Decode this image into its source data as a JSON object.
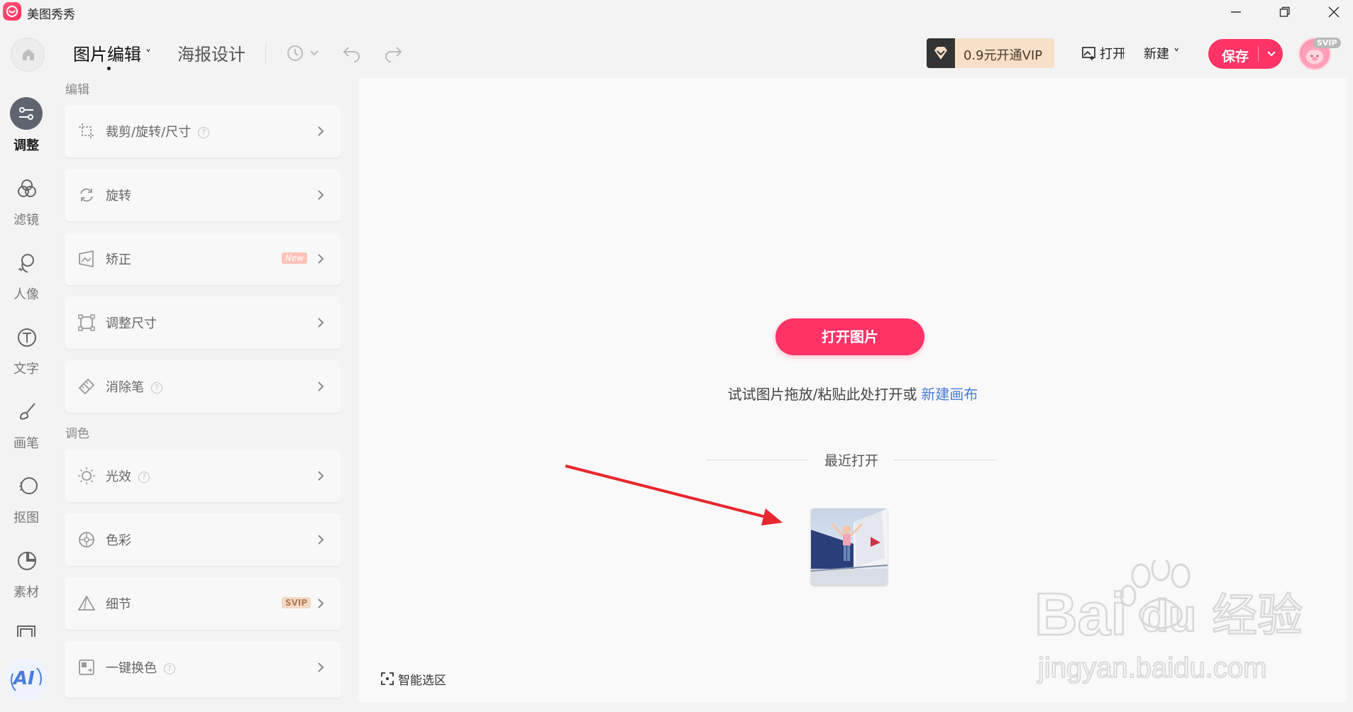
{
  "app": {
    "title": "美图秀秀"
  },
  "toolbar": {
    "tabs": [
      {
        "label": "图片编辑",
        "active": true
      },
      {
        "label": "海报设计",
        "active": false
      }
    ],
    "tab_caret": "˅",
    "vip_label": "0.9元开通VIP",
    "open_label": "打开",
    "new_label": "新建 ˅",
    "save_label": "保存",
    "avatar_badge": "SVIP"
  },
  "sidebar": {
    "items": [
      {
        "label": "调整",
        "icon": "sliders-icon",
        "active": true
      },
      {
        "label": "滤镜",
        "icon": "filter-circles-icon",
        "active": false
      },
      {
        "label": "人像",
        "icon": "portrait-icon",
        "active": false
      },
      {
        "label": "文字",
        "icon": "text-icon",
        "active": false
      },
      {
        "label": "画笔",
        "icon": "brush-icon",
        "active": false
      },
      {
        "label": "抠图",
        "icon": "cutout-icon",
        "active": false
      },
      {
        "label": "素材",
        "icon": "sticker-icon",
        "active": false
      }
    ],
    "ai_label": "AI"
  },
  "panel": {
    "sections": [
      {
        "title": "编辑"
      },
      {
        "title": "调色"
      }
    ],
    "tools": [
      {
        "label": "裁剪/旋转/尺寸",
        "icon": "crop-icon",
        "help": true,
        "tag": ""
      },
      {
        "label": "旋转",
        "icon": "rotate-icon",
        "help": false,
        "tag": ""
      },
      {
        "label": "矫正",
        "icon": "perspective-icon",
        "help": false,
        "tag": "New"
      },
      {
        "label": "调整尺寸",
        "icon": "resize-icon",
        "help": false,
        "tag": ""
      },
      {
        "label": "消除笔",
        "icon": "eraser-icon",
        "help": true,
        "tag": ""
      },
      {
        "label": "光效",
        "icon": "light-icon",
        "help": true,
        "tag": ""
      },
      {
        "label": "色彩",
        "icon": "color-palette-icon",
        "help": false,
        "tag": ""
      },
      {
        "label": "细节",
        "icon": "detail-triangle-icon",
        "help": false,
        "tag": "SVIP"
      },
      {
        "label": "一键换色",
        "icon": "color-swap-icon",
        "help": true,
        "tag": ""
      }
    ],
    "help_glyph": "?"
  },
  "canvas": {
    "open_image_label": "打开图片",
    "hint_text": "试试图片拖放/粘贴此处打开或",
    "hint_link": "新建画布",
    "recent_title": "最近打开",
    "smart_select_label": "智能选区"
  },
  "watermark": {
    "brand": "Bai",
    "brand_suffix": "du",
    "brand_cn": "经验",
    "url": "jingyan.baidu.com"
  },
  "colors": {
    "accent": "#ff3366",
    "link": "#4a7cd6",
    "vip_bg": "#f7dfc8",
    "nav_active": "#5f6470",
    "arrow": "#e8262e"
  }
}
